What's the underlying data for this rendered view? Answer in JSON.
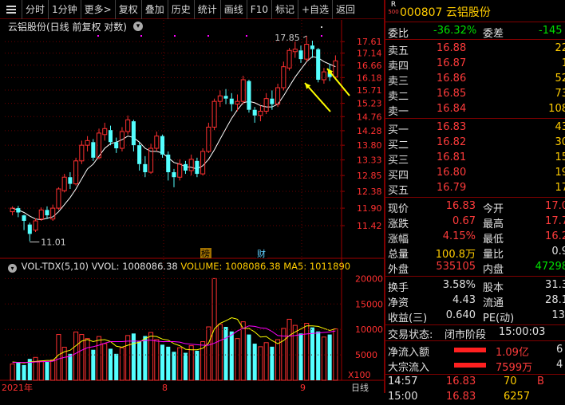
{
  "toolbar": {
    "items": [
      "分时",
      "1分钟",
      "更多>",
      "复权",
      "叠加",
      "历史",
      "统计",
      "画线",
      "F10",
      "标记",
      "+自选",
      "返回"
    ]
  },
  "chart": {
    "title": "云铝股份(日线 前复权 对数)",
    "title_icon": "▾",
    "price_ticks": [
      "17.61",
      "17.14",
      "16.66",
      "16.18",
      "15.71",
      "15.23",
      "14.76",
      "14.28",
      "13.80",
      "13.33",
      "12.85",
      "12.38",
      "11.90",
      "11.42"
    ],
    "high_label": "17.85",
    "low_label": "11.01",
    "markers": [
      "榜",
      "财"
    ],
    "date_labels": [
      "2021年",
      "8",
      "9"
    ],
    "colors": {
      "up": "#ff3030",
      "down": "#54ffff",
      "ma": "#ffffff",
      "ma2": "#ff00ff",
      "ma3": "#ffff00"
    },
    "candles": [
      {
        "o": 11.8,
        "c": 11.9,
        "h": 11.95,
        "l": 11.7
      },
      {
        "o": 11.9,
        "c": 11.78,
        "h": 11.96,
        "l": 11.65
      },
      {
        "o": 11.7,
        "c": 11.55,
        "h": 11.72,
        "l": 11.3
      },
      {
        "o": 11.45,
        "c": 11.2,
        "h": 11.5,
        "l": 11.01
      },
      {
        "o": 11.3,
        "c": 11.55,
        "h": 11.62,
        "l": 11.25
      },
      {
        "o": 11.6,
        "c": 11.85,
        "h": 11.92,
        "l": 11.55
      },
      {
        "o": 11.85,
        "c": 11.7,
        "h": 11.95,
        "l": 11.6
      },
      {
        "o": 11.6,
        "c": 11.9,
        "h": 12.0,
        "l": 11.55
      },
      {
        "o": 11.9,
        "c": 12.45,
        "h": 12.5,
        "l": 11.85
      },
      {
        "o": 12.4,
        "c": 12.8,
        "h": 12.9,
        "l": 12.35
      },
      {
        "o": 12.8,
        "c": 12.6,
        "h": 12.95,
        "l": 12.45
      },
      {
        "o": 12.6,
        "c": 13.3,
        "h": 13.4,
        "l": 12.55
      },
      {
        "o": 13.3,
        "c": 13.8,
        "h": 13.95,
        "l": 13.2
      },
      {
        "o": 13.8,
        "c": 13.95,
        "h": 14.1,
        "l": 13.6
      },
      {
        "o": 13.9,
        "c": 13.4,
        "h": 14.0,
        "l": 13.3
      },
      {
        "o": 13.4,
        "c": 14.2,
        "h": 14.35,
        "l": 13.35
      },
      {
        "o": 14.15,
        "c": 14.35,
        "h": 14.55,
        "l": 13.95
      },
      {
        "o": 14.3,
        "c": 13.9,
        "h": 14.45,
        "l": 13.8
      },
      {
        "o": 13.9,
        "c": 13.7,
        "h": 14.05,
        "l": 13.55
      },
      {
        "o": 13.7,
        "c": 14.25,
        "h": 14.4,
        "l": 13.6
      },
      {
        "o": 14.25,
        "c": 14.65,
        "h": 14.8,
        "l": 14.15
      },
      {
        "o": 14.6,
        "c": 13.8,
        "h": 14.65,
        "l": 13.6
      },
      {
        "o": 13.8,
        "c": 13.2,
        "h": 13.9,
        "l": 13.0
      },
      {
        "o": 13.2,
        "c": 12.95,
        "h": 13.45,
        "l": 12.8
      },
      {
        "o": 12.95,
        "c": 13.7,
        "h": 13.85,
        "l": 12.9
      },
      {
        "o": 13.7,
        "c": 14.1,
        "h": 14.25,
        "l": 13.6
      },
      {
        "o": 14.1,
        "c": 13.5,
        "h": 14.15,
        "l": 13.4
      },
      {
        "o": 13.5,
        "c": 12.95,
        "h": 13.6,
        "l": 12.7
      },
      {
        "o": 12.95,
        "c": 12.8,
        "h": 13.05,
        "l": 12.5
      },
      {
        "o": 12.8,
        "c": 13.2,
        "h": 13.35,
        "l": 12.7
      },
      {
        "o": 13.2,
        "c": 13.0,
        "h": 13.3,
        "l": 12.9
      },
      {
        "o": 13.0,
        "c": 13.35,
        "h": 13.5,
        "l": 12.85
      },
      {
        "o": 13.3,
        "c": 12.9,
        "h": 13.4,
        "l": 12.8
      },
      {
        "o": 12.9,
        "c": 13.6,
        "h": 13.7,
        "l": 12.85
      },
      {
        "o": 13.6,
        "c": 14.4,
        "h": 14.55,
        "l": 13.55
      },
      {
        "o": 14.4,
        "c": 15.3,
        "h": 15.4,
        "l": 14.3
      },
      {
        "o": 15.3,
        "c": 15.5,
        "h": 15.7,
        "l": 15.1
      },
      {
        "o": 15.5,
        "c": 15.4,
        "h": 15.75,
        "l": 15.2
      },
      {
        "o": 15.4,
        "c": 15.2,
        "h": 15.6,
        "l": 14.95
      },
      {
        "o": 15.2,
        "c": 15.3,
        "h": 15.55,
        "l": 14.95
      },
      {
        "o": 15.3,
        "c": 16.1,
        "h": 16.25,
        "l": 15.2
      },
      {
        "o": 16.05,
        "c": 15.0,
        "h": 16.1,
        "l": 14.9
      },
      {
        "o": 15.0,
        "c": 14.8,
        "h": 15.1,
        "l": 14.55
      },
      {
        "o": 14.8,
        "c": 14.95,
        "h": 15.15,
        "l": 14.6
      },
      {
        "o": 14.95,
        "c": 15.4,
        "h": 15.6,
        "l": 14.85
      },
      {
        "o": 15.4,
        "c": 15.2,
        "h": 15.7,
        "l": 15.0
      },
      {
        "o": 15.2,
        "c": 15.8,
        "h": 15.95,
        "l": 15.1
      },
      {
        "o": 15.8,
        "c": 16.6,
        "h": 16.8,
        "l": 15.7
      },
      {
        "o": 16.55,
        "c": 17.25,
        "h": 17.35,
        "l": 16.45
      },
      {
        "o": 17.2,
        "c": 17.3,
        "h": 17.6,
        "l": 16.95
      },
      {
        "o": 17.25,
        "c": 16.9,
        "h": 17.45,
        "l": 16.75
      },
      {
        "o": 16.9,
        "c": 17.5,
        "h": 17.85,
        "l": 16.8
      },
      {
        "o": 17.45,
        "c": 17.3,
        "h": 17.65,
        "l": 16.95
      },
      {
        "o": 17.3,
        "c": 16.1,
        "h": 17.35,
        "l": 16.0
      },
      {
        "o": 16.1,
        "c": 16.4,
        "h": 16.55,
        "l": 15.95
      },
      {
        "o": 16.4,
        "c": 16.2,
        "h": 16.7,
        "l": 16.05
      },
      {
        "o": 16.2,
        "c": 16.83,
        "h": 17.05,
        "l": 16.1
      }
    ],
    "ma_values": [
      11.9,
      11.85,
      11.78,
      11.68,
      11.6,
      11.58,
      11.62,
      11.66,
      11.8,
      12.0,
      12.2,
      12.45,
      12.75,
      13.05,
      13.2,
      13.45,
      13.7,
      13.85,
      13.9,
      13.98,
      14.1,
      14.05,
      13.9,
      13.7,
      13.6,
      13.6,
      13.55,
      13.4,
      13.25,
      13.2,
      13.12,
      13.1,
      13.05,
      13.15,
      13.35,
      13.65,
      14.0,
      14.35,
      14.7,
      15.0,
      15.25,
      15.3,
      15.25,
      15.15,
      15.1,
      15.1,
      15.2,
      15.5,
      15.85,
      16.2,
      16.5,
      16.8,
      17.0,
      16.95,
      16.8,
      16.7,
      16.6
    ]
  },
  "volume": {
    "header": {
      "indicator": "VOL-TDX(5,10)",
      "vvol": "VVOL: 1008086.38",
      "volume": "VOLUME: 1008086.38",
      "ma5": "MA5: 1011890"
    },
    "ticks": [
      "20000",
      "15000",
      "10000",
      "5000"
    ],
    "unit": "X100",
    "values": [
      3200,
      3600,
      3000,
      4200,
      4500,
      3800,
      3600,
      4000,
      9000,
      6500,
      5200,
      9500,
      9000,
      8200,
      6000,
      8600,
      7200,
      6200,
      5200,
      6400,
      8800,
      9200,
      7600,
      8700,
      9400,
      8000,
      7000,
      6600,
      5600,
      6400,
      5400,
      6800,
      5800,
      7600,
      10500,
      20000,
      11000,
      10500,
      9600,
      8200,
      11500,
      9000,
      7200,
      6600,
      7400,
      6600,
      8000,
      10200,
      12000,
      10800,
      9200,
      11200,
      10400,
      9600,
      8500,
      9000,
      10100
    ],
    "ma5": [
      3600,
      3500,
      3400,
      3600,
      3700,
      3800,
      3900,
      3900,
      5000,
      5600,
      5900,
      6800,
      7700,
      8000,
      7600,
      7900,
      8000,
      7600,
      6700,
      6500,
      6900,
      7200,
      7500,
      8200,
      8700,
      8600,
      8100,
      7900,
      7200,
      6800,
      6100,
      6000,
      6000,
      6300,
      7300,
      10100,
      11200,
      11700,
      12300,
      12000,
      10200,
      10200,
      9500,
      8500,
      8600,
      7800,
      7200,
      7800,
      8800,
      9500,
      10100,
      10700,
      10700,
      10600,
      10200,
      9800,
      10100
    ],
    "ma10": [
      3500,
      3500,
      3500,
      3500,
      3600,
      3650,
      3700,
      3750,
      4200,
      4500,
      4700,
      5300,
      5900,
      6400,
      6600,
      6900,
      7300,
      7600,
      7600,
      7600,
      7700,
      7700,
      7700,
      7800,
      7900,
      7700,
      7600,
      7600,
      7600,
      7500,
      7200,
      7100,
      7000,
      6900,
      6900,
      7300,
      7800,
      8300,
      8900,
      9700,
      10200,
      10700,
      10600,
      10300,
      10200,
      9600,
      8800,
      8700,
      8700,
      8800,
      9000,
      9100,
      9200,
      9300,
      9400,
      9500,
      9700
    ]
  },
  "quote": {
    "r_label": "R",
    "r_number": "500",
    "code_name": "000807 云铝股份",
    "weibi_label": "委比",
    "weibi_value": "-36.32%",
    "weicha_label": "委差",
    "weicha_value": "-145",
    "sell": [
      {
        "label": "卖五",
        "price": "16.88",
        "vol": "22"
      },
      {
        "label": "卖四",
        "price": "16.87",
        "vol": "1"
      },
      {
        "label": "卖三",
        "price": "16.86",
        "vol": "52"
      },
      {
        "label": "卖二",
        "price": "16.85",
        "vol": "73"
      },
      {
        "label": "卖一",
        "price": "16.84",
        "vol": "108"
      }
    ],
    "buy": [
      {
        "label": "买一",
        "price": "16.83",
        "vol": "43"
      },
      {
        "label": "买二",
        "price": "16.82",
        "vol": "30"
      },
      {
        "label": "买三",
        "price": "16.81",
        "vol": "15"
      },
      {
        "label": "买四",
        "price": "16.80",
        "vol": "19"
      },
      {
        "label": "买五",
        "price": "16.79",
        "vol": "17"
      }
    ],
    "stats": [
      {
        "l1": "现价",
        "v1": "16.83",
        "l2": "今开",
        "v2": "17.0"
      },
      {
        "l1": "涨跌",
        "v1": "0.67",
        "l2": "最高",
        "v2": "17.7"
      },
      {
        "l1": "涨幅",
        "v1": "4.15%",
        "l2": "最低",
        "v2": "16.2"
      },
      {
        "l1": "总量",
        "v1": "100.8万",
        "l2": "量比",
        "v2": "0.9"
      },
      {
        "l1": "外盘",
        "v1": "535105",
        "l2": "内盘",
        "v2": "47298"
      }
    ],
    "info": [
      {
        "l1": "换手",
        "v1": "3.58%",
        "l2": "股本",
        "v2": "31.3"
      },
      {
        "l1": "净资",
        "v1": "4.43",
        "l2": "流通",
        "v2": "28.1"
      },
      {
        "l1": "收益(三)",
        "v1": "0.640",
        "l2": "PE(动)",
        "v2": "13."
      }
    ],
    "status_label": "交易状态:",
    "status_value": "闭市阶段",
    "status_time": "15:00:03",
    "flows": [
      {
        "label": "净流入额",
        "value": "1.09亿",
        "extra": "6"
      },
      {
        "label": "大宗流入",
        "value": "7599万",
        "extra": "4"
      }
    ],
    "ticks": [
      {
        "time": "14:57",
        "price": "16.83",
        "vol": "70",
        "flag": "B"
      },
      {
        "time": "15:00",
        "price": "16.83",
        "vol": "6257",
        "flag": ""
      }
    ]
  }
}
